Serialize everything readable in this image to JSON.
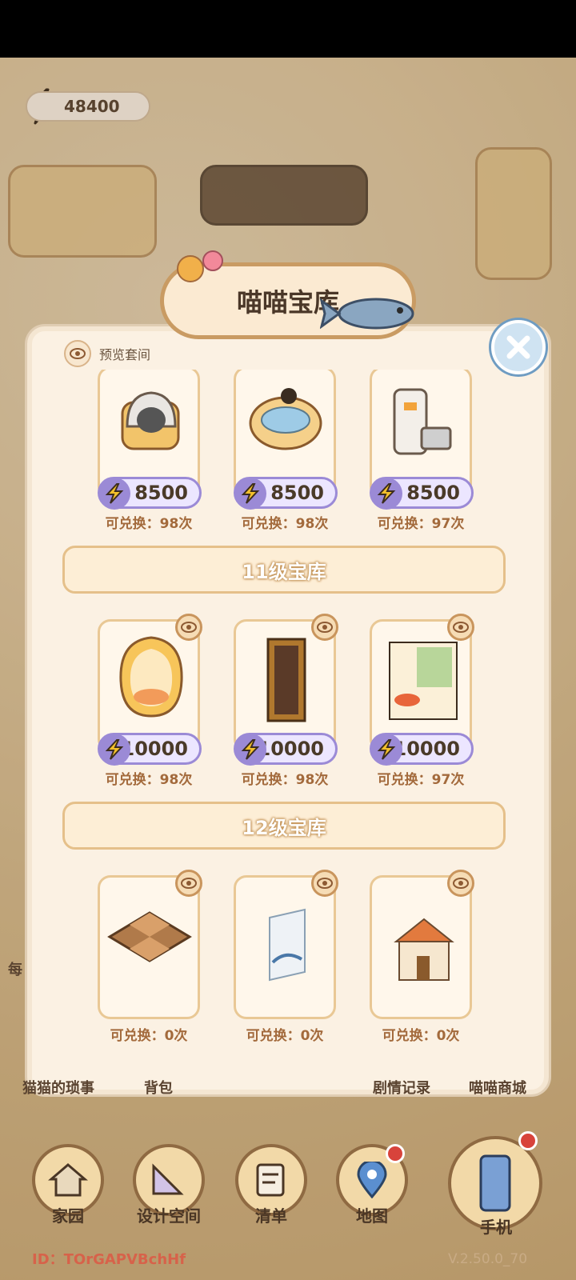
{
  "status_bar": {},
  "energy": {
    "value": "48400"
  },
  "title": "喵喵宝库",
  "preview": {
    "label": "预览套间"
  },
  "rows": [
    {
      "items": [
        {
          "name": "cat-litter-box",
          "price": "8500",
          "count": "可兑换：98次"
        },
        {
          "name": "cat-bed-bowl",
          "price": "8500",
          "count": "可兑换：98次"
        },
        {
          "name": "cat-feeder",
          "price": "8500",
          "count": "可兑换：97次"
        }
      ]
    },
    {
      "section": "11级宝库",
      "items": [
        {
          "name": "cat-egg-chair",
          "price": "10000",
          "count": "可兑换：98次"
        },
        {
          "name": "painting-frame",
          "price": "10000",
          "count": "可兑换：98次"
        },
        {
          "name": "window-room",
          "price": "10000",
          "count": "可兑换：97次"
        }
      ]
    },
    {
      "section": "12级宝库",
      "items": [
        {
          "name": "checker-floor",
          "count": "可兑换：0次"
        },
        {
          "name": "wall-art",
          "count": "可兑换：0次"
        },
        {
          "name": "castle-house",
          "count": "可兑换：0次"
        }
      ]
    }
  ],
  "bottom_labels": {
    "stories": "猫猫的琐事",
    "backpack": "背包",
    "plot": "剧情记录",
    "mall": "喵喵商城",
    "side_left": "每"
  },
  "nav": {
    "home": "家园",
    "design": "设计空间",
    "list": "清单",
    "map": "地图",
    "phone": "手机"
  },
  "footer": {
    "id": "ID：TOrGAPVBchHf",
    "version": "V.2.50.0_70"
  },
  "colors": {
    "accent": "#9b8ad6",
    "frame": "#e9c895",
    "title_border": "#c99b63"
  }
}
